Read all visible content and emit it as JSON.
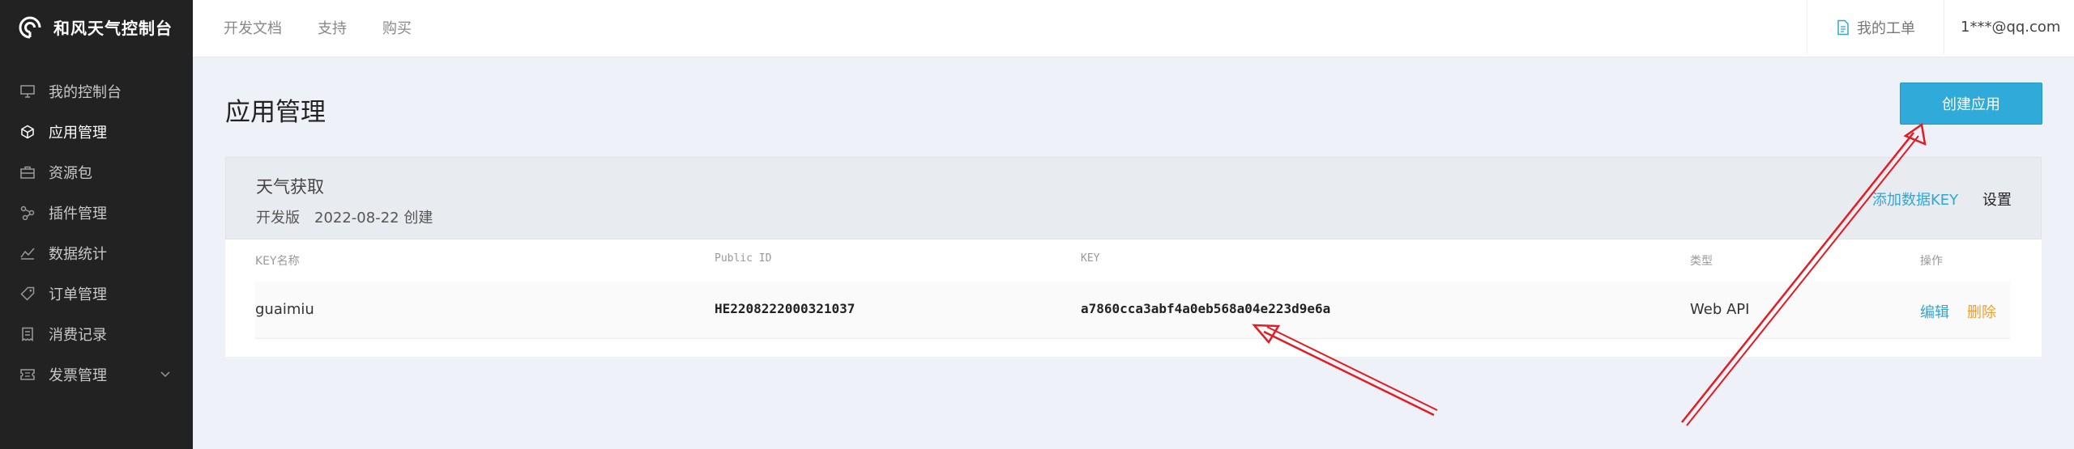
{
  "brand": {
    "name": "和风天气控制台"
  },
  "sidebar": {
    "items": [
      {
        "label": "我的控制台",
        "icon": "monitor-icon"
      },
      {
        "label": "应用管理",
        "icon": "cube-icon",
        "active": true
      },
      {
        "label": "资源包",
        "icon": "package-icon"
      },
      {
        "label": "插件管理",
        "icon": "plugin-icon"
      },
      {
        "label": "数据统计",
        "icon": "chart-icon"
      },
      {
        "label": "订单管理",
        "icon": "tag-icon"
      },
      {
        "label": "消费记录",
        "icon": "receipt-icon"
      },
      {
        "label": "发票管理",
        "icon": "ticket-icon"
      }
    ]
  },
  "topnav": {
    "docs": "开发文档",
    "support": "支持",
    "buy": "购买"
  },
  "header": {
    "ticket_label": "我的工单",
    "user_email": "1***@qq.com"
  },
  "page": {
    "title": "应用管理",
    "create_button": "创建应用"
  },
  "project": {
    "name": "天气获取",
    "plan": "开发版",
    "created": "2022-08-22 创建",
    "add_key": "添加数据KEY",
    "settings": "设置"
  },
  "table": {
    "headers": {
      "name": "KEY名称",
      "public_id": "Public ID",
      "key": "KEY",
      "type": "类型",
      "actions": "操作"
    },
    "rows": [
      {
        "name": "guaimiu",
        "public_id": "HE2208222000321037",
        "key": "a7860cca3abf4a0eb568a04e223d9e6a",
        "type": "Web API",
        "edit": "编辑",
        "delete": "删除"
      }
    ]
  },
  "colors": {
    "accent": "#30abd9",
    "sidebar_bg": "#222222",
    "delete": "#f0a030",
    "annotation": "#e31b23"
  }
}
